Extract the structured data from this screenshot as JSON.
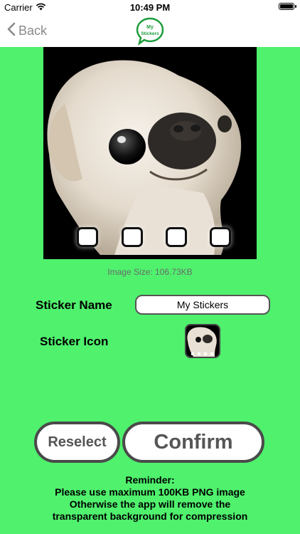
{
  "status_bar": {
    "carrier": "Carrier",
    "time": "10:49 PM",
    "icons": [
      "wifi-icon",
      "battery-icon"
    ]
  },
  "nav": {
    "back_label": "Back",
    "logo_text": "My Stickers"
  },
  "image_size_label": "Image Size: 106.73KB",
  "form": {
    "sticker_name_label": "Sticker Name",
    "sticker_name_value": "My Stickers",
    "sticker_icon_label": "Sticker Icon"
  },
  "buttons": {
    "reselect_label": "Reselect",
    "confirm_label": "Confirm"
  },
  "reminder": {
    "title": "Reminder:",
    "line1": "Please use maximum 100KB PNG image",
    "line2": "Otherwise the app will remove the",
    "line3": "transparent background for compression"
  },
  "colors": {
    "background": "#4ff16d",
    "button_border": "#4a4a4a"
  }
}
